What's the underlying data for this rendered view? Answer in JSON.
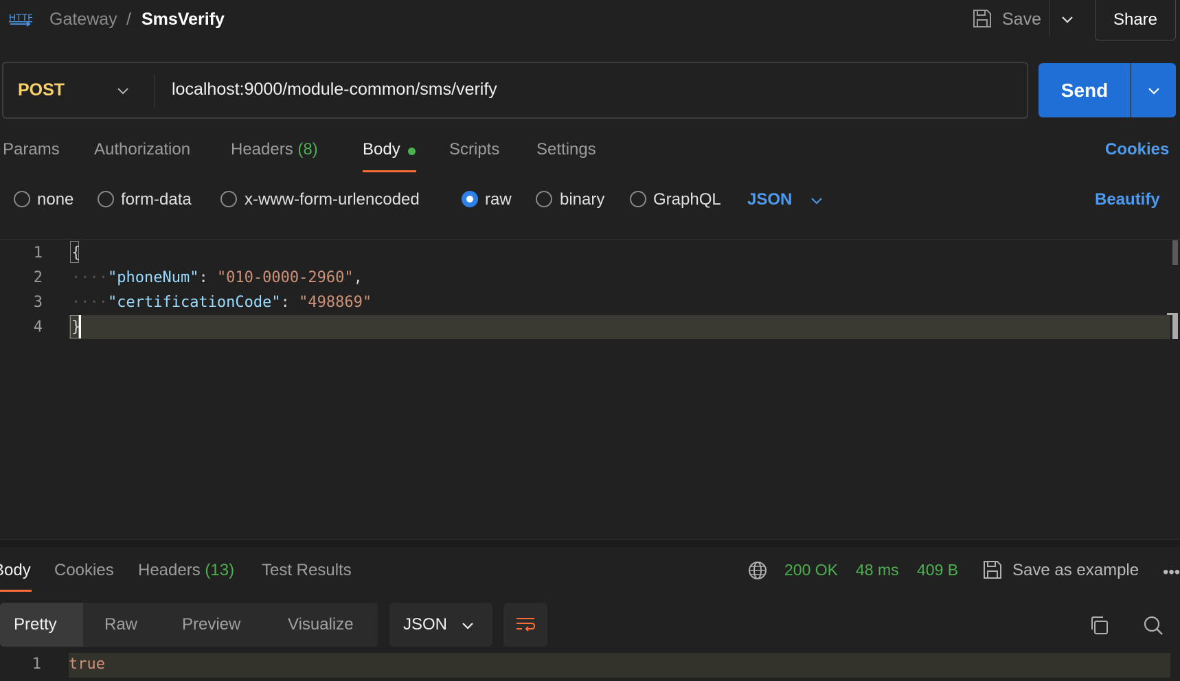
{
  "header": {
    "icon": "http-icon",
    "breadcrumb_parent": "Gateway",
    "breadcrumb_sep": "/",
    "breadcrumb_current": "SmsVerify",
    "save_label": "Save",
    "share_label": "Share"
  },
  "request": {
    "method": "POST",
    "url": "localhost:9000/module-common/sms/verify",
    "send_label": "Send"
  },
  "tabs": {
    "params": "Params",
    "authorization": "Authorization",
    "headers": "Headers",
    "headers_count": "(8)",
    "body": "Body",
    "scripts": "Scripts",
    "settings": "Settings",
    "cookies": "Cookies",
    "active": "Body"
  },
  "body_types": {
    "options": [
      "none",
      "form-data",
      "x-www-form-urlencoded",
      "raw",
      "binary",
      "GraphQL"
    ],
    "selected": "raw",
    "language": "JSON",
    "beautify_label": "Beautify"
  },
  "editor": {
    "line_numbers": [
      "1",
      "2",
      "3",
      "4"
    ],
    "open_brace": "{",
    "close_brace": "}",
    "key1": "\"phoneNum\"",
    "val1": "\"010-0000-2960\"",
    "key2": "\"certificationCode\"",
    "val2": "\"498869\""
  },
  "response": {
    "tabs": [
      "Body",
      "Cookies",
      "Headers",
      "Test Results"
    ],
    "headers_count": "(13)",
    "active_tab": "Body",
    "status": "200 OK",
    "time": "48 ms",
    "size": "409 B",
    "save_example_label": "Save as example",
    "view_modes": [
      "Pretty",
      "Raw",
      "Preview",
      "Visualize"
    ],
    "active_view": "Pretty",
    "format": "JSON",
    "line_number": "1",
    "content": "true"
  },
  "colors": {
    "accent_orange": "#ff6c37",
    "send_blue": "#1f6fd6",
    "link_blue": "#4d9bf0",
    "method_yellow": "#f6d06b",
    "status_green": "#4caf50",
    "background": "#212121"
  }
}
